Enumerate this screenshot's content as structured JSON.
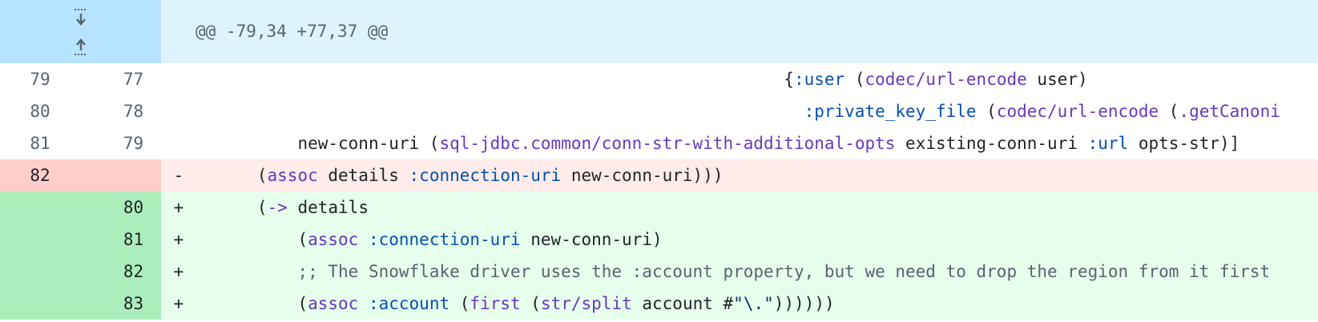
{
  "hunk": {
    "header": "@@ -79,34 +77,37 @@",
    "expand_down_icon": "expand-down-icon",
    "expand_up_icon": "expand-up-icon"
  },
  "lines": [
    {
      "type": "context",
      "old": "79",
      "new": "77",
      "marker": ""
    },
    {
      "type": "context",
      "old": "80",
      "new": "78",
      "marker": ""
    },
    {
      "type": "context",
      "old": "81",
      "new": "79",
      "marker": ""
    },
    {
      "type": "deletion",
      "old": "82",
      "new": "",
      "marker": "-"
    },
    {
      "type": "addition",
      "old": "",
      "new": "80",
      "marker": "+"
    },
    {
      "type": "addition",
      "old": "",
      "new": "81",
      "marker": "+"
    },
    {
      "type": "addition",
      "old": "",
      "new": "82",
      "marker": "+"
    },
    {
      "type": "addition",
      "old": "",
      "new": "83",
      "marker": "+"
    }
  ],
  "code": {
    "l0": {
      "indent": "                                                          ",
      "open": "{",
      "kw": ":user",
      "sp1": " (",
      "fn": "codec/url-encode",
      "rest": " user)"
    },
    "l1": {
      "indent": "                                                            ",
      "kw": ":private_key_file",
      "sp1": " (",
      "fn": "codec/url-encode",
      "sp2": " (",
      "fn2": ".getCanoni"
    },
    "l2": {
      "indent": "          ",
      "a": "new-conn-uri (",
      "fn": "sql-jdbc.common/conn-str-with-additional-opts",
      "b": " existing-conn-uri ",
      "kw": ":url",
      "c": " opts-str)]"
    },
    "l3": {
      "indent": "      ",
      "a": "(",
      "fn": "assoc",
      "b": " details ",
      "kw": ":connection-uri",
      "c": " new-conn-uri)))"
    },
    "l4": {
      "indent": "      ",
      "a": "(",
      "fn": "->",
      "b": " details"
    },
    "l5": {
      "indent": "          ",
      "a": "(",
      "fn": "assoc",
      "b": " ",
      "kw": ":connection-uri",
      "c": " new-conn-uri)"
    },
    "l6": {
      "indent": "          ",
      "comment": ";; The Snowflake driver uses the :account property, but we need to drop the region from it first"
    },
    "l7": {
      "indent": "          ",
      "a": "(",
      "fn": "assoc",
      "b": " ",
      "kw": ":account",
      "c": " (",
      "fn2": "first",
      "d": " (",
      "fn3": "str/split",
      "e": " account #",
      "str": "\"\\.\"",
      "f": "))))))"
    }
  }
}
